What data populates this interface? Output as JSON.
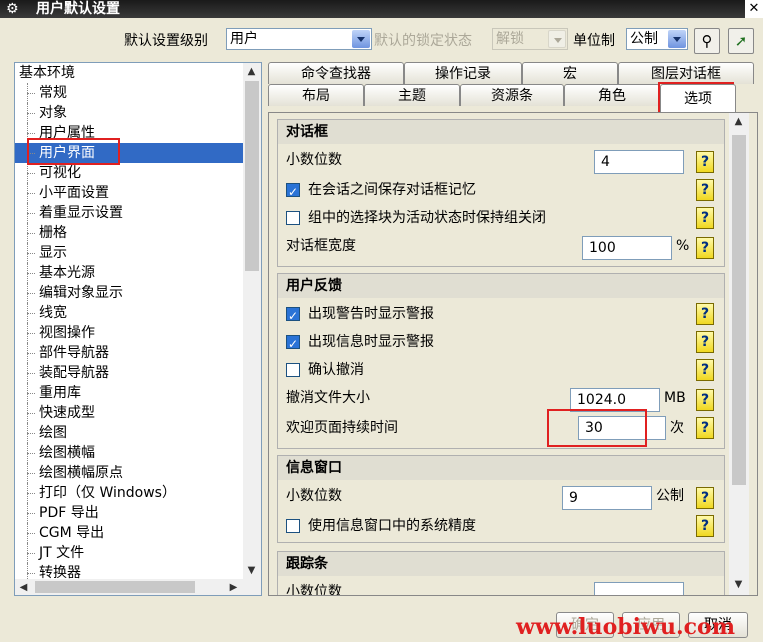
{
  "window": {
    "title": "用户默认设置",
    "close_glyph": "✕"
  },
  "toolbar": {
    "level_label": "默认设置级别",
    "level_value": "用户",
    "lock_label": "默认的锁定状态",
    "lock_value": "解锁",
    "unit_label": "单位制",
    "unit_value": "公制"
  },
  "tree": {
    "root": "基本环境",
    "items": [
      "常规",
      "对象",
      "用户属性",
      "用户界面",
      "可视化",
      "小平面设置",
      "着重显示设置",
      "栅格",
      "显示",
      "基本光源",
      "编辑对象显示",
      "线宽",
      "视图操作",
      "部件导航器",
      "装配导航器",
      "重用库",
      "快速成型",
      "绘图",
      "绘图横幅",
      "绘图横幅原点",
      "打印（仅 Windows）",
      "PDF 导出",
      "CGM 导出",
      "JT 文件",
      "转换器"
    ],
    "selected": "用户界面"
  },
  "tabs": {
    "row1": [
      "命令查找器",
      "操作记录",
      "宏",
      "图层对话框"
    ],
    "row2": [
      "布局",
      "主题",
      "资源条",
      "角色",
      "选项"
    ],
    "active": "选项"
  },
  "dialog_group": {
    "title": "对话框",
    "decimal_label": "小数位数",
    "decimal_value": "4",
    "save_memory_label": "在会话之间保存对话框记忆",
    "save_memory_checked": true,
    "keep_group_closed_label": "组中的选择块为活动状态时保持组关闭",
    "keep_group_closed_checked": false,
    "width_label": "对话框宽度",
    "width_value": "100",
    "width_unit": "%"
  },
  "feedback_group": {
    "title": "用户反馈",
    "warn_label": "出现警告时显示警报",
    "warn_checked": true,
    "info_label": "出现信息时显示警报",
    "info_checked": true,
    "confirm_undo_label": "确认撤消",
    "confirm_undo_checked": false,
    "undo_size_label": "撤消文件大小",
    "undo_size_value": "1024.0",
    "undo_size_unit": "MB",
    "welcome_label": "欢迎页面持续时间",
    "welcome_value": "30",
    "welcome_unit": "次"
  },
  "info_group": {
    "title": "信息窗口",
    "decimal_label": "小数位数",
    "decimal_value": "9",
    "decimal_unit": "公制",
    "sys_precision_label": "使用信息窗口中的系统精度",
    "sys_precision_checked": false
  },
  "trace_group": {
    "title": "跟踪条",
    "decimal_label": "小数位数"
  },
  "buttons": {
    "ok": "确定",
    "apply": "应用",
    "cancel": "取消"
  },
  "watermark": "www.luobiwu.com"
}
